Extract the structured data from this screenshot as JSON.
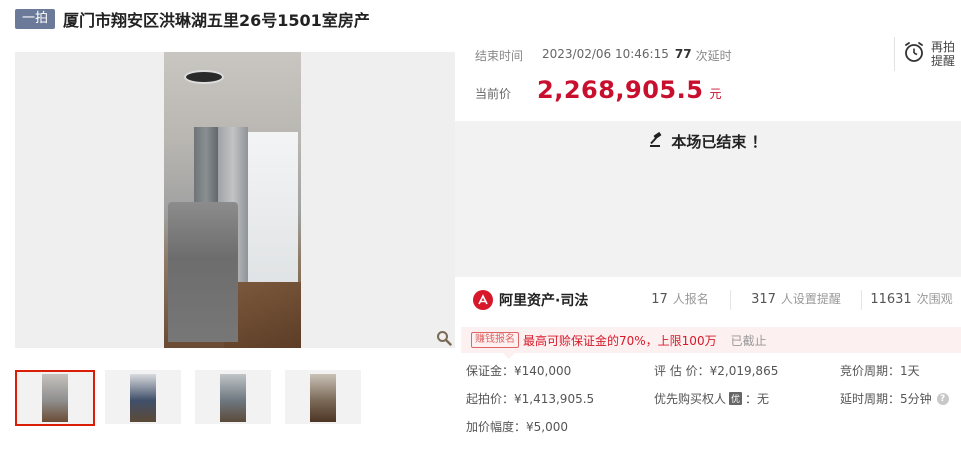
{
  "header": {
    "auction_tag": "一拍",
    "title": "厦门市翔安区洪琳湖五里26号1501室房产"
  },
  "gallery": {
    "thumbnails": [
      "thumb-1",
      "thumb-2",
      "thumb-3",
      "thumb-4"
    ],
    "active_index": 0
  },
  "auction": {
    "end_time_label": "结束时间",
    "end_time": "2023/02/06 10:46:15",
    "delay_count": "77",
    "delay_label": "次延时",
    "reminder_label": "再拍提醒",
    "current_price_label": "当前价",
    "current_price": "2,268,905.5",
    "price_unit": "元",
    "ended_message": "本场已结束 ！"
  },
  "stats": {
    "brand": "阿里资产·司法",
    "signups": "17",
    "signups_label": "人报名",
    "reminders": "317",
    "reminders_label": "人设置提醒",
    "views": "11631",
    "views_label": "次围观"
  },
  "promo": {
    "badge": "赚钱报名",
    "text": "最高可赊保证金的70%，上限100万",
    "status": "已截止"
  },
  "info": {
    "deposit": "保证金：¥140,000",
    "appraisal": "评 估 价：¥2,019,865",
    "bid_cycle": "竞价周期：1天",
    "start_price": "起拍价：¥1,413,905.5",
    "priority_label": "优先购买权人",
    "priority_icon": "优",
    "priority_value": "：无",
    "delay_cycle": "延时周期：5分钟",
    "increment": "加价幅度：¥5,000"
  },
  "colors": {
    "price_red": "#c8102e",
    "brand_red": "#d7182a",
    "tag_bg": "#6b7a99",
    "active_thumb_border": "#d81e06"
  }
}
